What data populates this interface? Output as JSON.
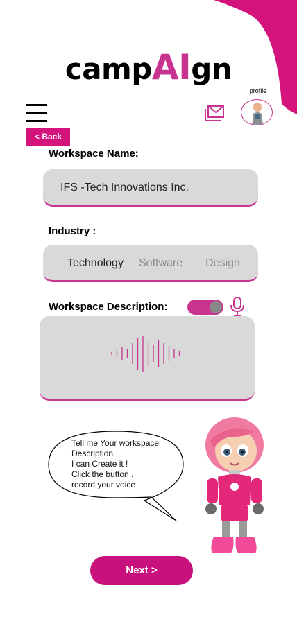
{
  "brand": {
    "logo_prefix": "camp",
    "logo_ai": "AI",
    "logo_suffix": "gn",
    "accent_color": "#c8338f",
    "button_color": "#c8117d"
  },
  "header": {
    "menu_icon": "hamburger-menu-icon",
    "mail_icon": "mail-icon",
    "profile_label": "profile",
    "avatar_icon": "profile-avatar"
  },
  "nav": {
    "back_label": "< Back"
  },
  "form": {
    "workspace_name_label": "Workspace Name:",
    "workspace_name_value": "IFS -Tech Innovations Inc.",
    "industry_label": "Industry :",
    "industry_options": [
      "Technology",
      "Software",
      "Design"
    ],
    "industry_selected": "Technology",
    "description_label": "Workspace Description:",
    "voice_toggle_on": true,
    "mic_icon": "microphone-icon",
    "waveform_icon": "audio-waveform-icon"
  },
  "assistant": {
    "line1": "Tell me Your workspace",
    "line2": "Description",
    "line3": "I can Create it !",
    "line4": "Click the button .",
    "line5": "record your voice",
    "character": "assistant-robot-illustration"
  },
  "footer": {
    "next_label": "Next >"
  }
}
